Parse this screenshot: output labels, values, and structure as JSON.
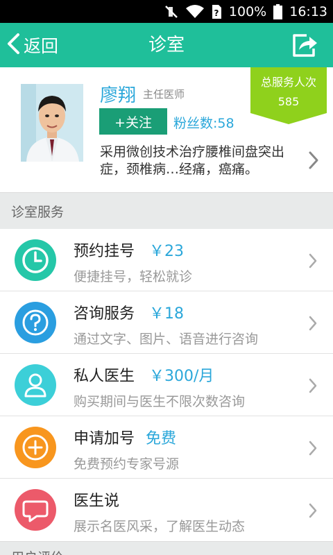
{
  "status_bar": {
    "battery": "100%",
    "time": "16:13",
    "icons": [
      "mute-icon",
      "wifi-icon",
      "sim-icon",
      "battery-icon"
    ]
  },
  "header": {
    "back_label": "返回",
    "title": "诊室",
    "share_icon": "share-icon"
  },
  "doctor": {
    "name": "廖翔",
    "title": "主任医师",
    "follow_label": "+关注",
    "fans_label": "粉丝数:",
    "fans_count": "58",
    "intro": "采用微创技术治疗腰椎间盘突出症，颈椎病…经痛，癌痛。"
  },
  "badge": {
    "label": "总服务人次",
    "value": "585",
    "color": "#8fd11c"
  },
  "section_title": "诊室服务",
  "services": [
    {
      "name": "预约挂号",
      "price": "￥23",
      "desc": "便捷挂号，轻松就诊",
      "icon": "clock-icon",
      "color": "#25c7a8"
    },
    {
      "name": "咨询服务",
      "price": "￥18",
      "desc": "通过文字、图片、语音进行咨询",
      "icon": "question-icon",
      "color": "#2a9ee0"
    },
    {
      "name": "私人医生",
      "price": "￥300/月",
      "desc": "购买期间与医生不限次数咨询",
      "icon": "person-icon",
      "color": "#3ccfd8"
    },
    {
      "name": "申请加号",
      "price": "免费",
      "desc": "免费预约专家号源",
      "icon": "plus-icon",
      "color": "#f8961e"
    },
    {
      "name": "医生说",
      "price": "",
      "desc": "展示名医风采，了解医生动态",
      "icon": "speech-bubble-icon",
      "color": "#ec5a6a"
    }
  ],
  "bottom_section_title": "用户评价"
}
